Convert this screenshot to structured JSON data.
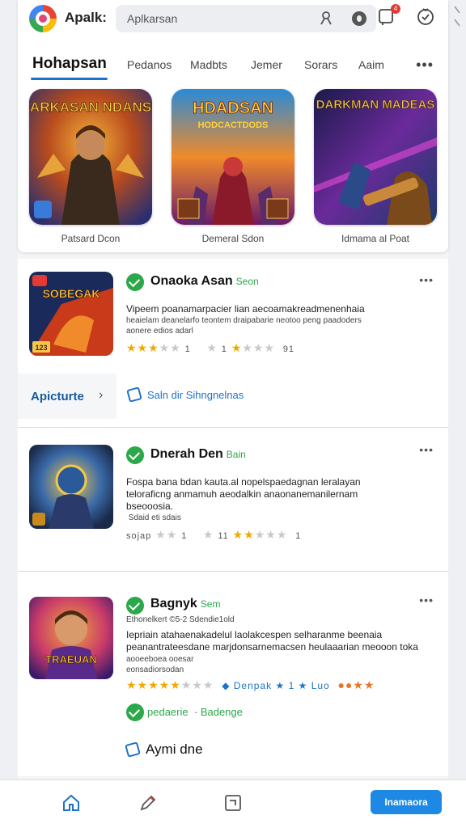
{
  "header": {
    "app_name": "Apalk:",
    "search_placeholder": "Aplkarsan",
    "notification_count": "4"
  },
  "tabs": {
    "active": "Hohapsan",
    "items": [
      "Pedanos",
      "Madbts",
      "Jemer",
      "Sorars",
      "Aaim"
    ]
  },
  "featured": [
    {
      "image_text": "DARKASAN NDANSU",
      "caption": "Patsard Dcon"
    },
    {
      "image_text": "HDADSAN",
      "image_sub": "HODCACTDODS",
      "caption": "Demeral Sdon"
    },
    {
      "image_text": "DARKMAN MADEAS",
      "caption": "Idmama al Poat"
    }
  ],
  "apps": [
    {
      "thumb_text": "SOBEGAK",
      "thumb_badge": "123",
      "title": "Onaoka Asan",
      "tag": "Seon",
      "desc_lines": [
        "Vipeem poanamarpacier lian aecoamakreadmenenhaia",
        "heaielam deanelarfo teontem draipabarie neotoo peng paadoders",
        "aonere edios adarl"
      ],
      "rating_left": "1",
      "rating_mid": "1",
      "rating_right": "91"
    },
    {
      "title": "Dnerah Den",
      "tag": "Bain",
      "desc_lines": [
        "Fospa bana bdan kauta.al nopelspaedagnan leralayan",
        "teloraficng anmamuh aeodalkin anaonanemanilernam",
        "bseooosia."
      ],
      "sub_line": " Sdaid eti sdais",
      "rating_text": "sojap",
      "rating_left": "1",
      "rating_mid": "11",
      "rating_right": "1"
    },
    {
      "thumb_text": "TRAEUAN",
      "title": "Bagnyk",
      "tag": "Sem",
      "subtitle": "Ethonelkert ©5-2 Sdendie1old",
      "desc_lines": [
        "Iepriain atahaenakadelul laolakcespen selharanme beenaia",
        "peanantrateesdane marjdonsarnemacsen heulaaarian meooon toka",
        "aooeeboea ooesar"
      ],
      "sub_line": "eonsadiorsodan",
      "badge_text": "Denpak",
      "badge_num": "1",
      "badge_extra": "Luo",
      "status_label": "pedaerie",
      "status_extra": "Badenge",
      "link_label": "Aymi dne"
    }
  ],
  "left_tab": {
    "label": "Apicturte"
  },
  "section_link": {
    "label": "Saln dir Sihngnelnas"
  },
  "bottom_nav": {
    "install_label": "Inamaora"
  },
  "colors": {
    "accent": "#1e73c8",
    "verified": "#2aa84a",
    "star": "#f2a800",
    "button": "#1e88e5"
  }
}
